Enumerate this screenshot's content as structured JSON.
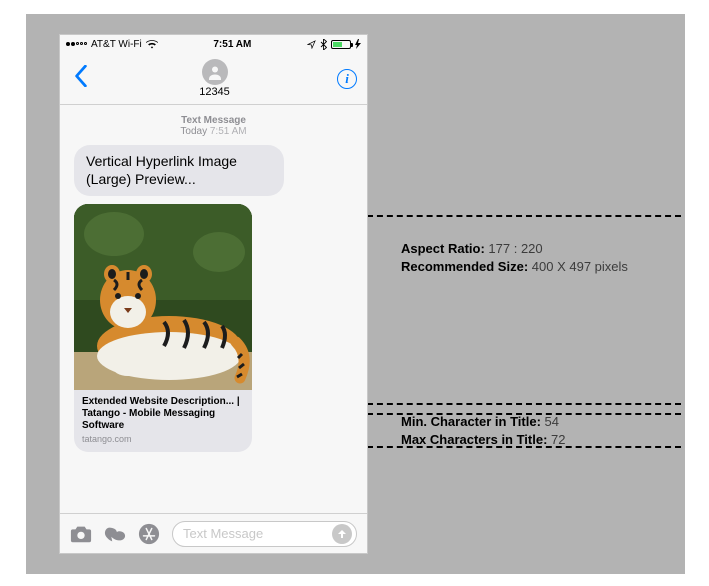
{
  "status": {
    "carrier": "AT&T Wi-Fi",
    "time": "7:51 AM"
  },
  "nav": {
    "contact": "12345"
  },
  "timestamp": {
    "label": "Text Message",
    "date": "Today",
    "time": "7:51 AM"
  },
  "message": {
    "text": "Vertical Hyperlink Image (Large) Preview..."
  },
  "preview": {
    "title": "Extended Website Description... | Tatango - Mobile Messaging Software",
    "domain": "tatango.com",
    "image_hint": "Tiger lying down, green foliage background"
  },
  "input": {
    "placeholder": "Text Message"
  },
  "annotations": {
    "image": {
      "aspect_label": "Aspect Ratio:",
      "aspect_value": "177 : 220",
      "size_label": "Recommended Size:",
      "size_value": "400 X 497 pixels"
    },
    "title": {
      "min_label": "Min. Character in Title:",
      "min_value": "54",
      "max_label": "Max Characters in Title:",
      "max_value": "72"
    }
  }
}
